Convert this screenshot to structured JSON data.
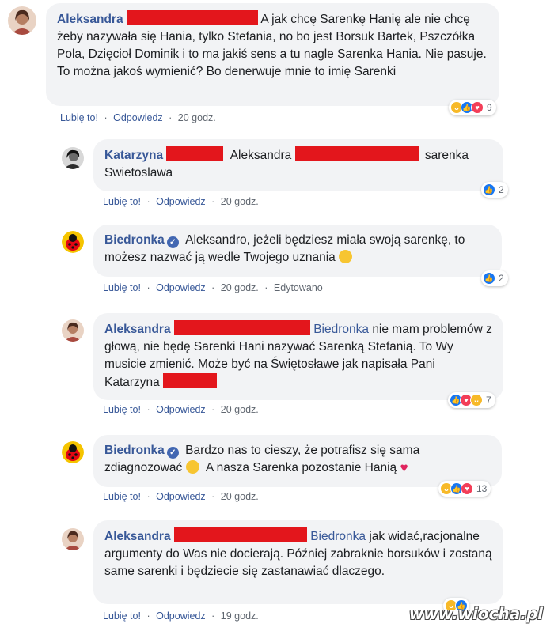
{
  "comments": [
    {
      "author": "Aleksandra",
      "text": "A jak chcę Sarenkę Hanię ale nie chcę żeby nazywała się Hania, tylko Stefania, no bo jest Borsuk Bartek, Pszczółka Pola, Dzięcioł Dominik i to ma jakiś sens a tu nagle Sarenka Hania. Nie pasuje. To można jakoś wymienić? Bo denerwuje mnie to imię Sarenki",
      "like": "Lubię to!",
      "reply": "Odpowiedz",
      "time": "20 godz.",
      "reactions": [
        "haha",
        "like",
        "love"
      ],
      "count": "9"
    },
    {
      "author": "Katarzyna",
      "mention": "Aleksandra",
      "text": "sarenka Swietoslawa",
      "like": "Lubię to!",
      "reply": "Odpowiedz",
      "time": "20 godz.",
      "reactions": [
        "like"
      ],
      "count": "2"
    },
    {
      "author": "Biedronka",
      "verified": true,
      "text": "Aleksandro, jeżeli będziesz miała swoją sarenkę, to możesz nazwać ją wedle Twojego uznania",
      "like": "Lubię to!",
      "reply": "Odpowiedz",
      "time": "20 godz.",
      "edited": "Edytowano",
      "reactions": [
        "like"
      ],
      "count": "2"
    },
    {
      "author": "Aleksandra",
      "mention": "Biedronka",
      "text": "nie mam problemów z głową, nie będę Sarenki Hani nazywać Sarenką Stefanią. To Wy musicie zmienić. Może być na Świętosławe jak napisała Pani Katarzyna",
      "like": "Lubię to!",
      "reply": "Odpowiedz",
      "time": "20 godz.",
      "reactions": [
        "like",
        "love",
        "haha"
      ],
      "count": "7"
    },
    {
      "author": "Biedronka",
      "verified": true,
      "text_a": "Bardzo nas to cieszy, że potrafisz się sama zdiagnozować",
      "text_b": "A nasza Sarenka pozostanie Hanią",
      "like": "Lubię to!",
      "reply": "Odpowiedz",
      "time": "20 godz.",
      "reactions": [
        "haha",
        "like",
        "love"
      ],
      "count": "13"
    },
    {
      "author": "Aleksandra",
      "mention": "Biedronka",
      "text": "jak widać,racjonalne argumenty do Was nie docierają. Później zabraknie borsuków i zostaną same sarenki i będziecie się zastanawiać dlaczego.",
      "like": "Lubię to!",
      "reply": "Odpowiedz",
      "time": "19 godz."
    }
  ],
  "separator": "·",
  "watermark": "www.wiocha.pl",
  "colors": {
    "link": "#385898",
    "bubble": "#f2f3f5",
    "redaction": "#e3161c",
    "like": "#1877f2",
    "love": "#f33e58",
    "haha": "#f7b928"
  }
}
